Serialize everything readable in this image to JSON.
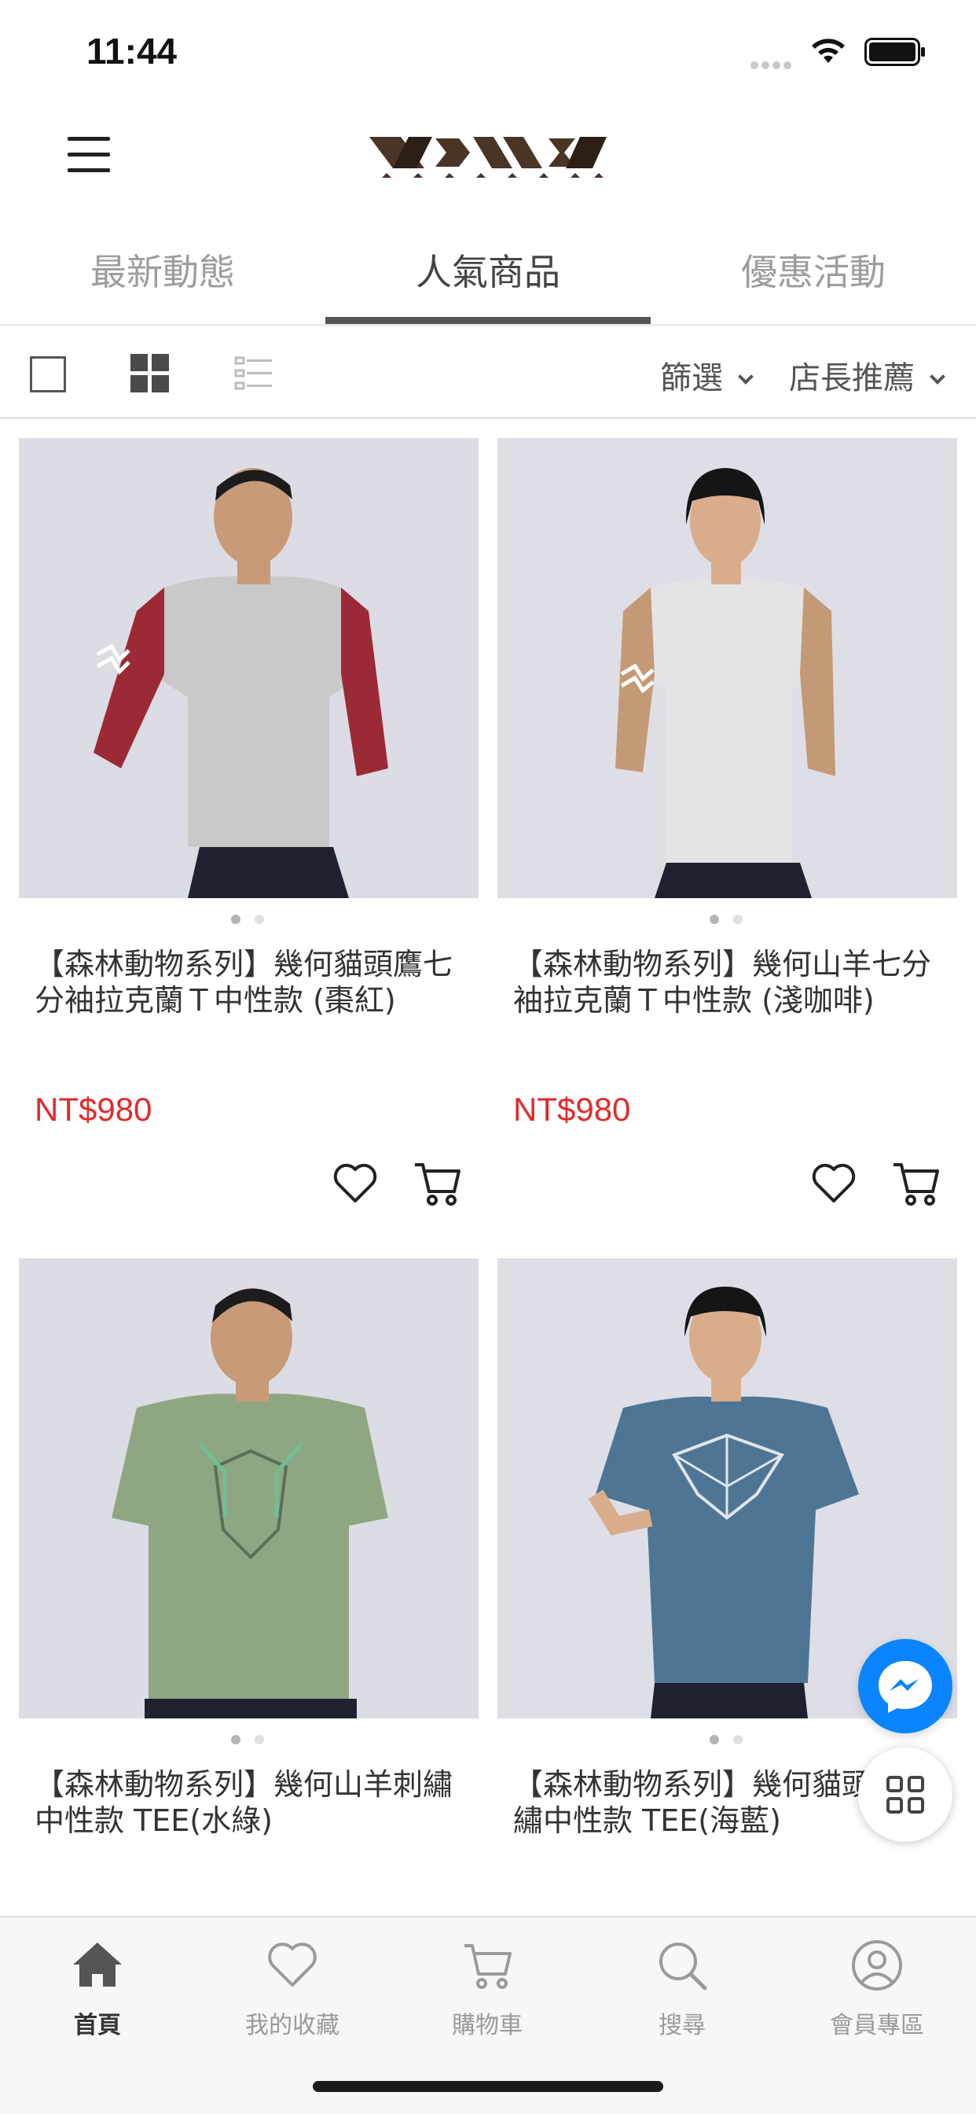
{
  "status_bar": {
    "time": "11:44"
  },
  "tabs": [
    {
      "label": "最新動態"
    },
    {
      "label": "人氣商品"
    },
    {
      "label": "優惠活動"
    }
  ],
  "toolbar": {
    "filter_label": "篩選",
    "sort_label": "店長推薦"
  },
  "products": [
    {
      "title": "【森林動物系列】幾何貓頭鷹七分袖拉克蘭Ｔ中性款 (棗紅)",
      "price": "NT$980",
      "image": "man-raglan-burgundy"
    },
    {
      "title": "【森林動物系列】幾何山羊七分袖拉克蘭Ｔ中性款 (淺咖啡)",
      "price": "NT$980",
      "image": "woman-raglan-tan"
    },
    {
      "title": "【森林動物系列】幾何山羊刺繡中性款 TEE(水綠)",
      "image": "man-tee-sage-green"
    },
    {
      "title": "【森林動物系列】幾何貓頭鷹刺繡中性款 TEE(海藍)",
      "image": "woman-tee-sea-blue"
    }
  ],
  "bottom_nav": [
    {
      "label": "首頁",
      "icon": "home-icon"
    },
    {
      "label": "我的收藏",
      "icon": "heart-icon"
    },
    {
      "label": "購物車",
      "icon": "cart-icon"
    },
    {
      "label": "搜尋",
      "icon": "search-icon"
    },
    {
      "label": "會員專區",
      "icon": "user-icon"
    }
  ],
  "colors": {
    "price": "#e02b2b",
    "messenger": "#0a84ff",
    "tab_indicator": "#555555"
  }
}
